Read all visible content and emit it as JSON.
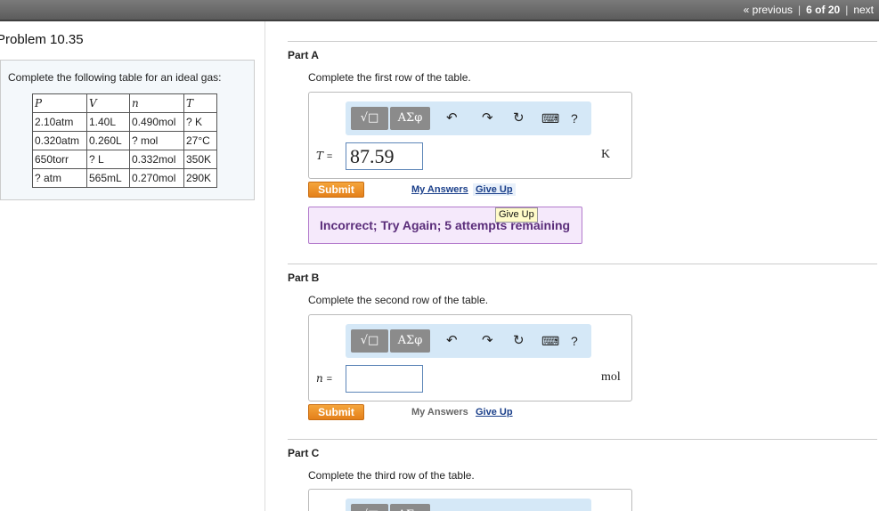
{
  "nav": {
    "previous_label": "« previous",
    "counter": "6 of 20",
    "next_label": "next"
  },
  "problem": {
    "title": "Problem 10.35",
    "instruction": "Complete the following table for an ideal gas:",
    "table": {
      "headers": [
        "P",
        "V",
        "n",
        "T"
      ],
      "rows": [
        [
          "2.10atm",
          "1.40L",
          "0.490mol",
          "? K"
        ],
        [
          "0.320atm",
          "0.260L",
          "? mol",
          "27°C"
        ],
        [
          "650torr",
          "? L",
          "0.332mol",
          "350K"
        ],
        [
          "? atm",
          "565mL",
          "0.270mol",
          "290K"
        ]
      ]
    }
  },
  "toolbar": {
    "template_icon": "√□",
    "greek_label": "ΑΣφ",
    "undo_icon": "undo-icon",
    "redo_icon": "redo-icon",
    "reset_icon": "reset-icon",
    "keyboard_icon": "keyboard-icon",
    "help_label": "?"
  },
  "parts": {
    "a": {
      "title": "Part A",
      "text": "Complete the first row of the table.",
      "variable": "T",
      "equals": "=",
      "value": "87.59",
      "unit": "K",
      "submit_label": "Submit",
      "my_answers_label": "My Answers",
      "give_up_label": "Give Up",
      "feedback": "Incorrect; Try Again; 5 attempts remaining",
      "tooltip": "Give Up"
    },
    "b": {
      "title": "Part B",
      "text": "Complete the second row of the table.",
      "variable": "n",
      "equals": "=",
      "value": "",
      "unit": "mol",
      "submit_label": "Submit",
      "my_answers_label": "My Answers",
      "give_up_label": "Give Up"
    },
    "c": {
      "title": "Part C",
      "text": "Complete the third row of the table."
    }
  }
}
